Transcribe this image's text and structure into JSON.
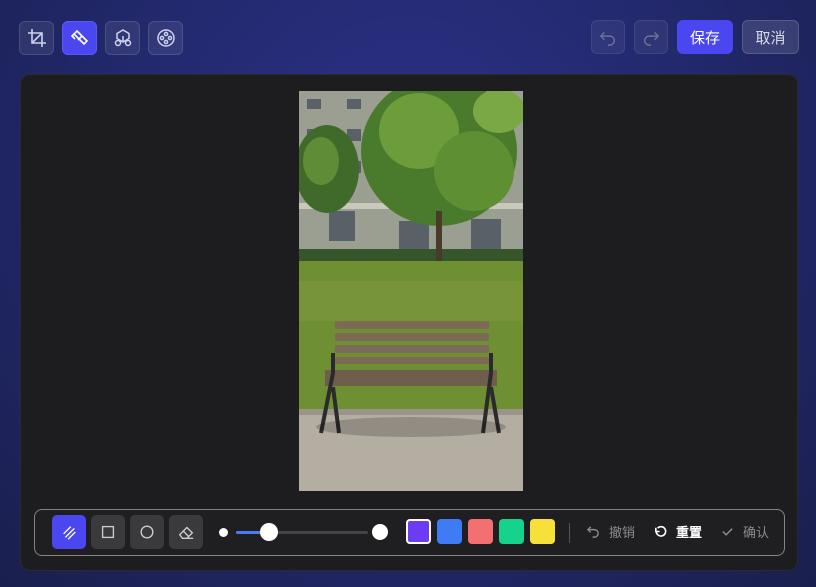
{
  "header": {
    "tools": [
      {
        "icon": "crop-icon",
        "active": false
      },
      {
        "icon": "brush-icon",
        "active": true
      },
      {
        "icon": "mosaic-icon",
        "active": false
      },
      {
        "icon": "filter-icon",
        "active": false
      }
    ],
    "undo_icon": "undo-icon",
    "redo_icon": "redo-icon",
    "save_label": "保存",
    "cancel_label": "取消"
  },
  "drawbar": {
    "tools": [
      {
        "icon": "pen-icon",
        "active": true
      },
      {
        "icon": "rectangle-icon",
        "active": false
      },
      {
        "icon": "circle-icon",
        "active": false
      },
      {
        "icon": "eraser-icon",
        "active": false
      }
    ],
    "brush_size_fraction": 0.25,
    "colors": [
      "#6c3cf5",
      "#3f7bf5",
      "#f47070",
      "#15d38c",
      "#f7e03a"
    ],
    "selected_color": "#6c3cf5",
    "undo_label": "撤销",
    "reset_label": "重置",
    "confirm_label": "确认"
  }
}
